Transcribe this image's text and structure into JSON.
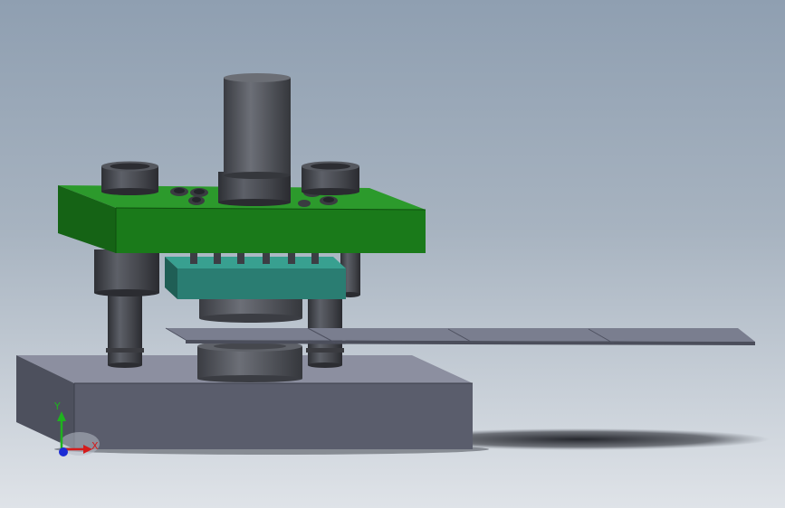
{
  "view": {
    "background_top": "#8f9fb1",
    "background_bottom": "#dfe3e8"
  },
  "colors": {
    "die_set_plate": "#1a7a1a",
    "stripper_plate": "#2a7d72",
    "base_block": "#5a5d6c",
    "steel_parts": "#3f4147",
    "strip_material": "#7a7e8f"
  },
  "triad": {
    "y_label": "Y",
    "x_label": "X",
    "y_color": "#1fb21f",
    "x_color": "#d41b1b",
    "z_color": "#1b2bd4"
  }
}
